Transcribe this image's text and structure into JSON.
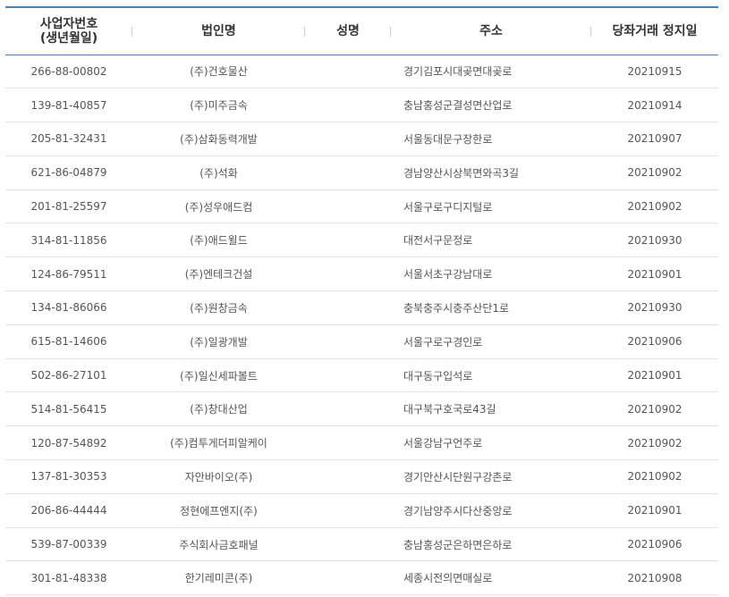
{
  "headers": {
    "bizno_line1": "사업자번호",
    "bizno_line2": "(생년월일)",
    "corp": "법인명",
    "name": "성명",
    "addr": "주소",
    "date": "당좌거래 정지일"
  },
  "rows": [
    {
      "bizno": "266-88-00802",
      "corp": "(주)건호물산",
      "name": "",
      "addr": "경기김포시대곶면대곶로",
      "date": "20210915"
    },
    {
      "bizno": "139-81-40857",
      "corp": "(주)미주금속",
      "name": "",
      "addr": "충남홍성군결성면산업로",
      "date": "20210914"
    },
    {
      "bizno": "205-81-32431",
      "corp": "(주)삼화동력개발",
      "name": "",
      "addr": "서울동대문구장한로",
      "date": "20210907"
    },
    {
      "bizno": "621-86-04879",
      "corp": "(주)석화",
      "name": "",
      "addr": "경남양산시상북면와곡3길",
      "date": "20210902"
    },
    {
      "bizno": "201-81-25597",
      "corp": "(주)성우애드컴",
      "name": "",
      "addr": "서울구로구디지털로",
      "date": "20210902"
    },
    {
      "bizno": "314-81-11856",
      "corp": "(주)애드윌드",
      "name": "",
      "addr": "대전서구문정로",
      "date": "20210930"
    },
    {
      "bizno": "124-86-79511",
      "corp": "(주)엔테크건설",
      "name": "",
      "addr": "서울서초구강남대로",
      "date": "20210901"
    },
    {
      "bizno": "134-81-86066",
      "corp": "(주)원창금속",
      "name": "",
      "addr": "충북충주시충주산단1로",
      "date": "20210930"
    },
    {
      "bizno": "615-81-14606",
      "corp": "(주)일광개발",
      "name": "",
      "addr": "서울구로구경인로",
      "date": "20210906"
    },
    {
      "bizno": "502-86-27101",
      "corp": "(주)일신세파볼트",
      "name": "",
      "addr": "대구동구입석로",
      "date": "20210901"
    },
    {
      "bizno": "514-81-56415",
      "corp": "(주)창대산업",
      "name": "",
      "addr": "대구북구호국로43길",
      "date": "20210902"
    },
    {
      "bizno": "120-87-54892",
      "corp": "(주)컴투게더피알케이",
      "name": "",
      "addr": "서울강남구언주로",
      "date": "20210902"
    },
    {
      "bizno": "137-81-30353",
      "corp": "자안바이오(주)",
      "name": "",
      "addr": "경기안산시단원구강촌로",
      "date": "20210902"
    },
    {
      "bizno": "206-86-44444",
      "corp": "정현에프엔지(주)",
      "name": "",
      "addr": "경기남양주시다산중앙로",
      "date": "20210901"
    },
    {
      "bizno": "539-87-00339",
      "corp": "주식회사금호패널",
      "name": "",
      "addr": "충남홍성군은하면은하로",
      "date": "20210906"
    },
    {
      "bizno": "301-81-48338",
      "corp": "한기레미콘(주)",
      "name": "",
      "addr": "세종시전의면매실로",
      "date": "20210908"
    }
  ]
}
